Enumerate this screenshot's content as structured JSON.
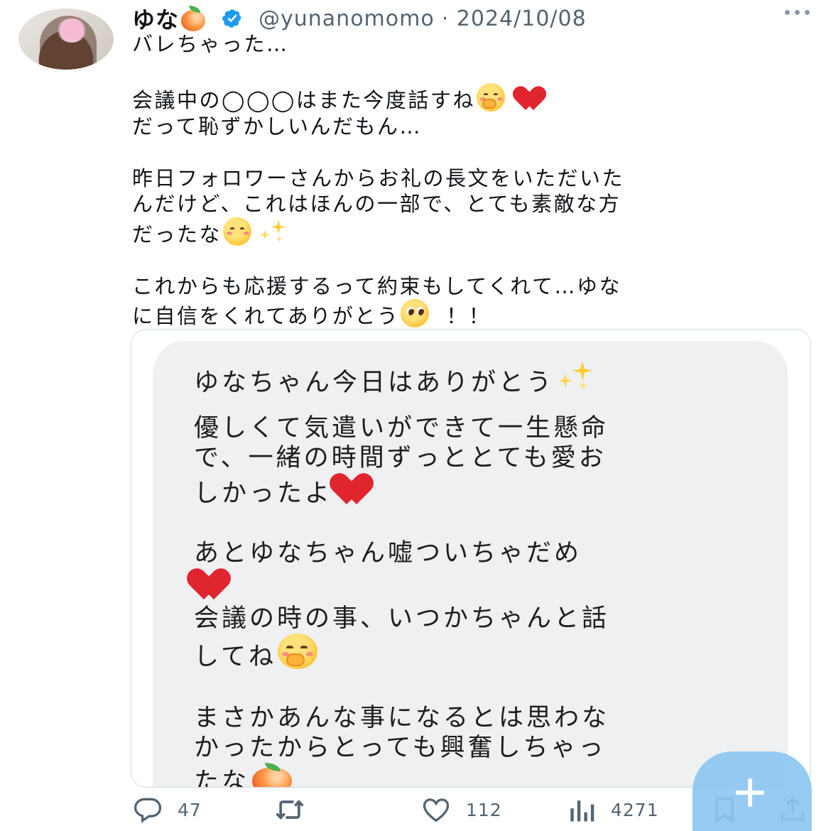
{
  "tweet": {
    "display_name": "ゆな",
    "name_emoji_icon": "peach-icon",
    "verified_icon": "verified-badge-icon",
    "handle": "@yunanomomo",
    "date": "· 2024/10/08",
    "more_icon": "more-options-icon",
    "lines": [
      "バレちゃった…",
      "",
      "会議中の◯◯◯はまた今度話すね",
      "だって恥ずかしいんだもん…",
      "",
      "昨日フォロワーさんからお礼の長文をいただいた",
      "んだけど、これはほんの一部で、とても素敵な方",
      "だったな",
      "",
      "これからも応援するって約束もしてくれて…ゆな",
      "に自信をくれてありがとう",
      "！！"
    ]
  },
  "media": {
    "lines": [
      "ゆなちゃん今日はありがとう",
      "優しくて気遣いができて一生懸命",
      "で、一緒の時間ずっととても愛お",
      "しかったよ",
      "あとゆなちゃん嘘ついちゃだめ",
      "会議の時の事、いつかちゃんと話",
      "してね",
      "まさかあんな事になるとは思わな",
      "かったからとっても興奮しちゃっ",
      "たな"
    ]
  },
  "actions": {
    "reply_count": "47",
    "retweet_count": "",
    "like_count": "112",
    "views_count": "4271",
    "reply_icon": "reply-icon",
    "retweet_icon": "retweet-icon",
    "like_icon": "heart-icon",
    "views_icon": "views-icon",
    "bookmark_icon": "bookmark-icon",
    "share_icon": "share-icon"
  },
  "fab": {
    "icon": "compose-plus-icon"
  },
  "colors": {
    "accent": "#1d9bf0",
    "fab": "#8cc7f2",
    "muted": "#536471",
    "heart": "#e0252f"
  }
}
